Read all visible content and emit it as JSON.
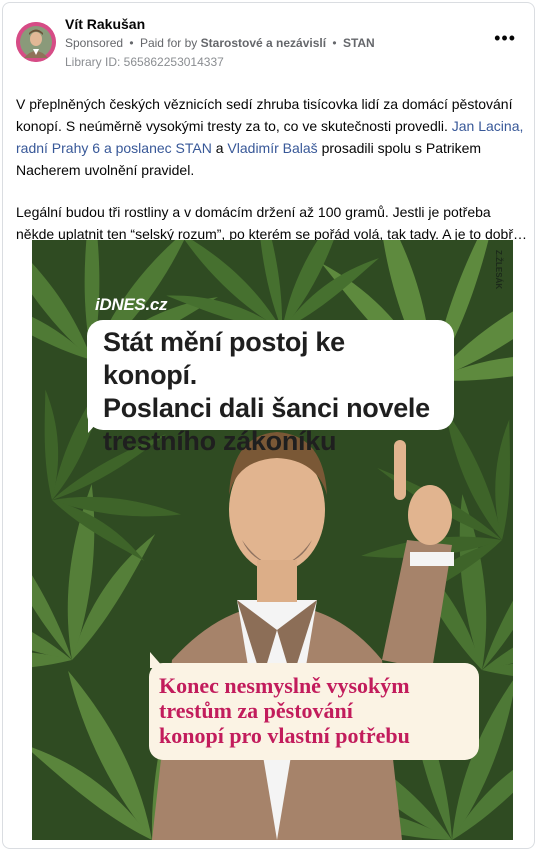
{
  "post": {
    "author": "Vít Rakušan",
    "sponsored": "Sponsored",
    "bullet1": "•",
    "paid_prefix": "Paid for by",
    "payer": "Starostové a nezávislí",
    "bullet2": "•",
    "payer_short": "STAN",
    "library_id": "Library ID: 565862253014337",
    "more_label": "•••",
    "para1_a": "V přeplněných českých věznicích sedí zhruba tisícovka lidí za domácí pěstování konopí. S neúměrně vysokými tresty za to, co ve skutečnosti provedli.",
    "para1_link1": "Jan Lacina, radní Prahy 6 a poslanec STAN",
    "para1_and": "a",
    "para1_link2": "Vladimír Balaš",
    "para1_b": "prosadili spolu s Patrikem Nacherem uvolnění pravidel.",
    "para2_line1": "Legální budou tři rostliny a v domácím držení až 100 gramů. Jestli je potřeba",
    "para2_line2": "někde uplatnit ten “selský rozum”, po kterém se pořád volá, tak tady. A je to dobře…"
  },
  "ad_image": {
    "brand": "iDNES.cz",
    "watermark": "Z.ŽLESÁK",
    "headline_1": "Stát mění postoj ke konopí.",
    "headline_2": "Poslanci dali šanci novele",
    "headline_3": "trestního zákoníku",
    "sub_1": "Konec nesmyslně vysokým",
    "sub_2": "trestům za pěstování",
    "sub_3": "konopí pro vlastní potřebu"
  },
  "colors": {
    "link": "#385898",
    "leaf_dark": "#2f4b22",
    "leaf_light": "#5e8a3e",
    "accent_pink": "#c21c5c"
  }
}
